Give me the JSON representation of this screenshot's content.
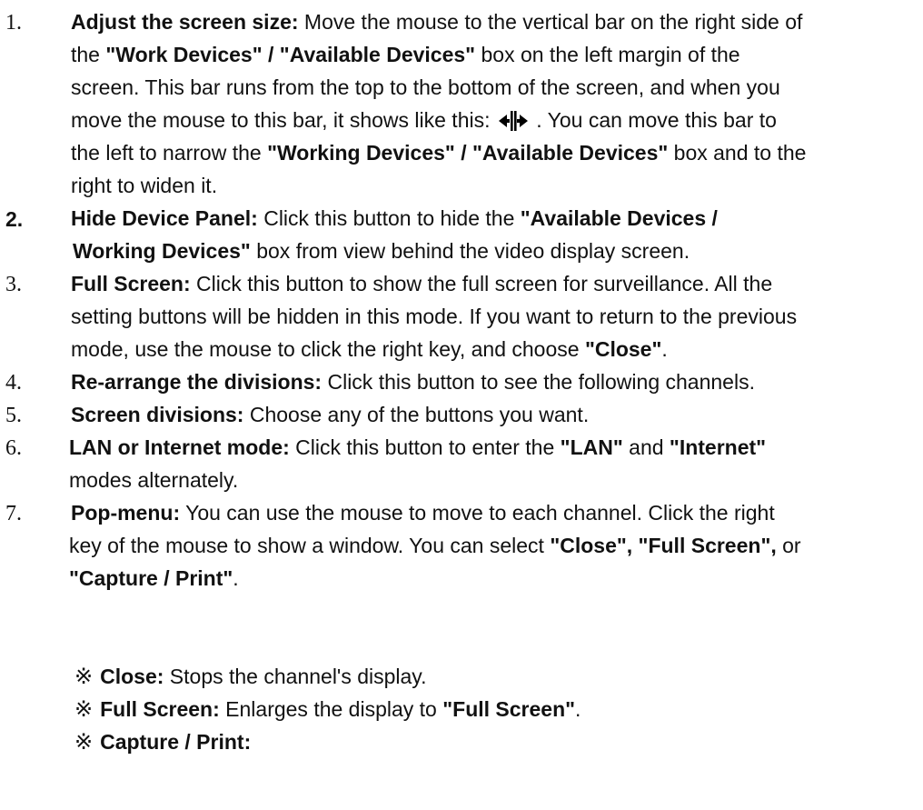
{
  "items": [
    {
      "num": "1.",
      "title": "Adjust the screen size:",
      "l1": " Move the mouse to the vertical bar on the right side of",
      "l2a": "the ",
      "l2b": "\"Work Devices\" / \"Available Devices\"",
      "l2c": " box on the left margin of the",
      "l3": "screen. This bar runs from the top to the bottom of the screen, and when you",
      "l4a": "move the mouse to this bar, it shows like this: ",
      "l4b": " . You can move this bar to",
      "l5a": "the left to narrow the ",
      "l5b": "\"Working Devices\" / \"Available Devices\"",
      "l5c": " box and to the",
      "l6": "right to widen it."
    },
    {
      "num": "2.",
      "title": "Hide Device Panel:",
      "l1a": " Click this button to hide the ",
      "l1b": "\"Available Devices /",
      "l2a": "Working Devices\"",
      "l2b": " box from view behind the video display screen."
    },
    {
      "num": "3.",
      "title": "Full Screen:",
      "l1": " Click this button to show the full screen for surveillance. All the",
      "l2": "setting buttons will be hidden in this mode. If you want to return to the previous",
      "l3a": "mode, use the mouse to click the right key, and choose ",
      "l3b": "\"Close\"",
      "l3c": "."
    },
    {
      "num": "4.",
      "title": "Re-arrange the divisions:",
      "l1": " Click this button to see the following channels."
    },
    {
      "num": "5.",
      "title": "Screen divisions:",
      "l1": " Choose any of the buttons you want."
    },
    {
      "num": "6.",
      "title": "LAN or Internet mode:",
      "l1a": " Click this button to enter the ",
      "l1b": "\"LAN\"",
      "l1c": " and ",
      "l1d": "\"Internet\"",
      "l2": "modes alternately."
    },
    {
      "num": "7.",
      "title": "Pop-menu:",
      "l1": " You can use the mouse to move to each channel. Click the right",
      "l2a": "key of the mouse to show a window. You can select ",
      "l2b": "\"Close\", \"Full Screen\",",
      "l2c": " or",
      "l3a": "\"Capture / Print\"",
      "l3b": "."
    }
  ],
  "subitems": [
    {
      "mark": "※",
      "title": "Close:",
      "text": " Stops the channel's display."
    },
    {
      "mark": "※",
      "title": "Full Screen:",
      "text": " Enlarges the display to ",
      "bold": "\"Full Screen\"",
      "end": "."
    },
    {
      "mark": "※",
      "title": "Capture / Print:",
      "text": ""
    }
  ],
  "icons": {
    "resize": "horizontal-resize-cursor-icon"
  }
}
